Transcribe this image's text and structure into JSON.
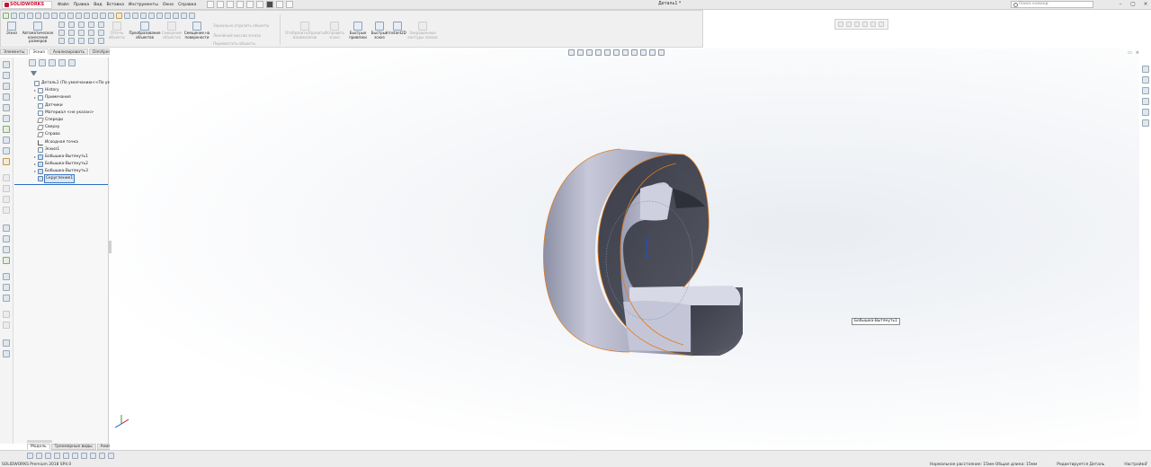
{
  "app": {
    "brand": "SOLIDWORKS",
    "document_title": "Деталь1 *"
  },
  "menu": [
    "Файл",
    "Правка",
    "Вид",
    "Вставка",
    "Инструменты",
    "Окно",
    "Справка"
  ],
  "search": {
    "placeholder": "Поиск команд"
  },
  "command_manager": {
    "sketch": "Эскиз",
    "smart_dimension": "Автоматическое нанесение размеров",
    "convert": "Преобразование объектов",
    "offset_surface": "Смещение на поверхности",
    "trim": "Отсечь объекты",
    "offset": "Смещение объектов",
    "mirror": "Зеркально отразить объекты",
    "linear_pattern": "Линейный массив эскиза",
    "move": "Переместить объекты",
    "display_relations": "Отобразить/Удалить взаимосвязи",
    "repair": "Исправить эскиз",
    "quick_snaps": "Быстрые привязки",
    "rapid_sketch": "Быстрый эскиз",
    "instant2d": "Instant2D",
    "shaded_contours": "Закрашенные контуры эскиза"
  },
  "tabs": [
    "Элементы",
    "Эскиз",
    "Анализировать",
    "DimXpert",
    "Добавления SOLIDWORKS",
    "SOLIDWORKS MBD"
  ],
  "tree": [
    {
      "label": "Деталь1  (По умолчанию<<По умолча",
      "icon": "part",
      "expand": false
    },
    {
      "label": "History",
      "icon": "folder",
      "expand": true
    },
    {
      "label": "Примечания",
      "icon": "folder",
      "expand": true
    },
    {
      "label": "Датчики",
      "icon": "folder",
      "expand": false
    },
    {
      "label": "Материал <не указан>",
      "icon": "material",
      "expand": false
    },
    {
      "label": "Спереди",
      "icon": "plane",
      "expand": false
    },
    {
      "label": "Сверху",
      "icon": "plane",
      "expand": false
    },
    {
      "label": "Справа",
      "icon": "plane",
      "expand": false
    },
    {
      "label": "Исходная точка",
      "icon": "origin",
      "expand": false
    },
    {
      "label": "Эскиз1",
      "icon": "sketch",
      "expand": false
    },
    {
      "label": "Бобышка-Вытянуть1",
      "icon": "feature",
      "expand": true
    },
    {
      "label": "Бобышка-Вытянуть2",
      "icon": "feature",
      "expand": true
    },
    {
      "label": "Бобышка-Вытянуть3",
      "icon": "feature",
      "expand": true
    },
    {
      "label": "Скругление1",
      "icon": "feature",
      "expand": false,
      "selected": true
    }
  ],
  "bottom_tabs": [
    "Модель",
    "Трехмерные виды",
    "Анимация1"
  ],
  "viewport": {
    "tooltip": "Бобышка-Вытянуть1"
  },
  "status": {
    "left": "SOLIDWORKS Premium 2018 SP4.0",
    "distance": "Нормальное расстояние: 15мм Общая длина: 15мм",
    "editing": "Редактируется Деталь",
    "custom": "Настройка"
  },
  "colors": {
    "model_face": "#b6b8cc",
    "model_dark": "#4a4c58",
    "edge": "#e07a1e",
    "selection": "#3b79c3"
  }
}
